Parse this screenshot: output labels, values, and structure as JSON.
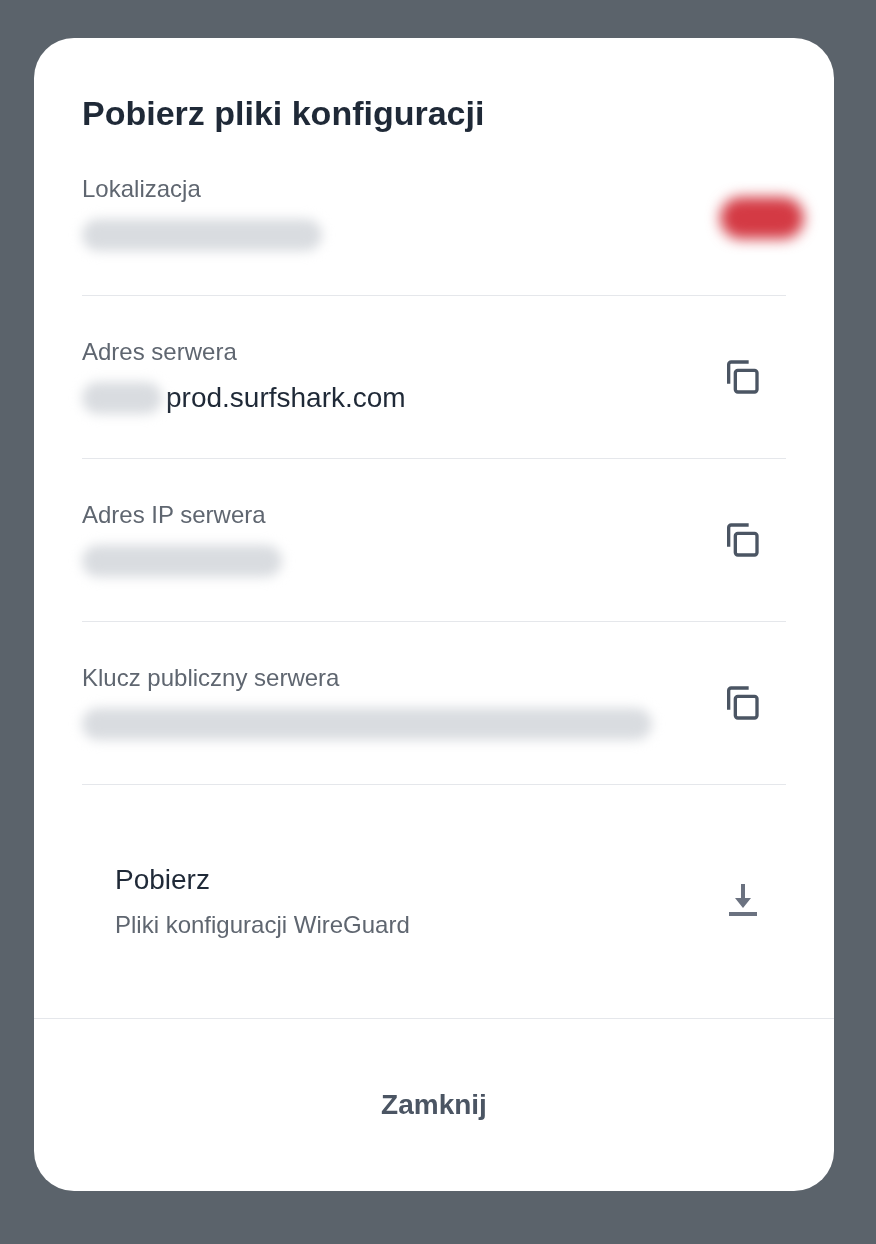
{
  "dialog": {
    "title": "Pobierz pliki konfiguracji",
    "fields": [
      {
        "kind": "location",
        "label": "Lokalizacja"
      },
      {
        "kind": "copy",
        "label": "Adres serwera",
        "value": "prod.surfshark.com"
      },
      {
        "kind": "copy",
        "label": "Adres IP serwera"
      },
      {
        "kind": "copy",
        "label": "Klucz publiczny serwera"
      }
    ],
    "download": {
      "title": "Pobierz",
      "subtitle": "Pliki konfiguracji WireGuard"
    },
    "close_button": "Zamknij"
  }
}
